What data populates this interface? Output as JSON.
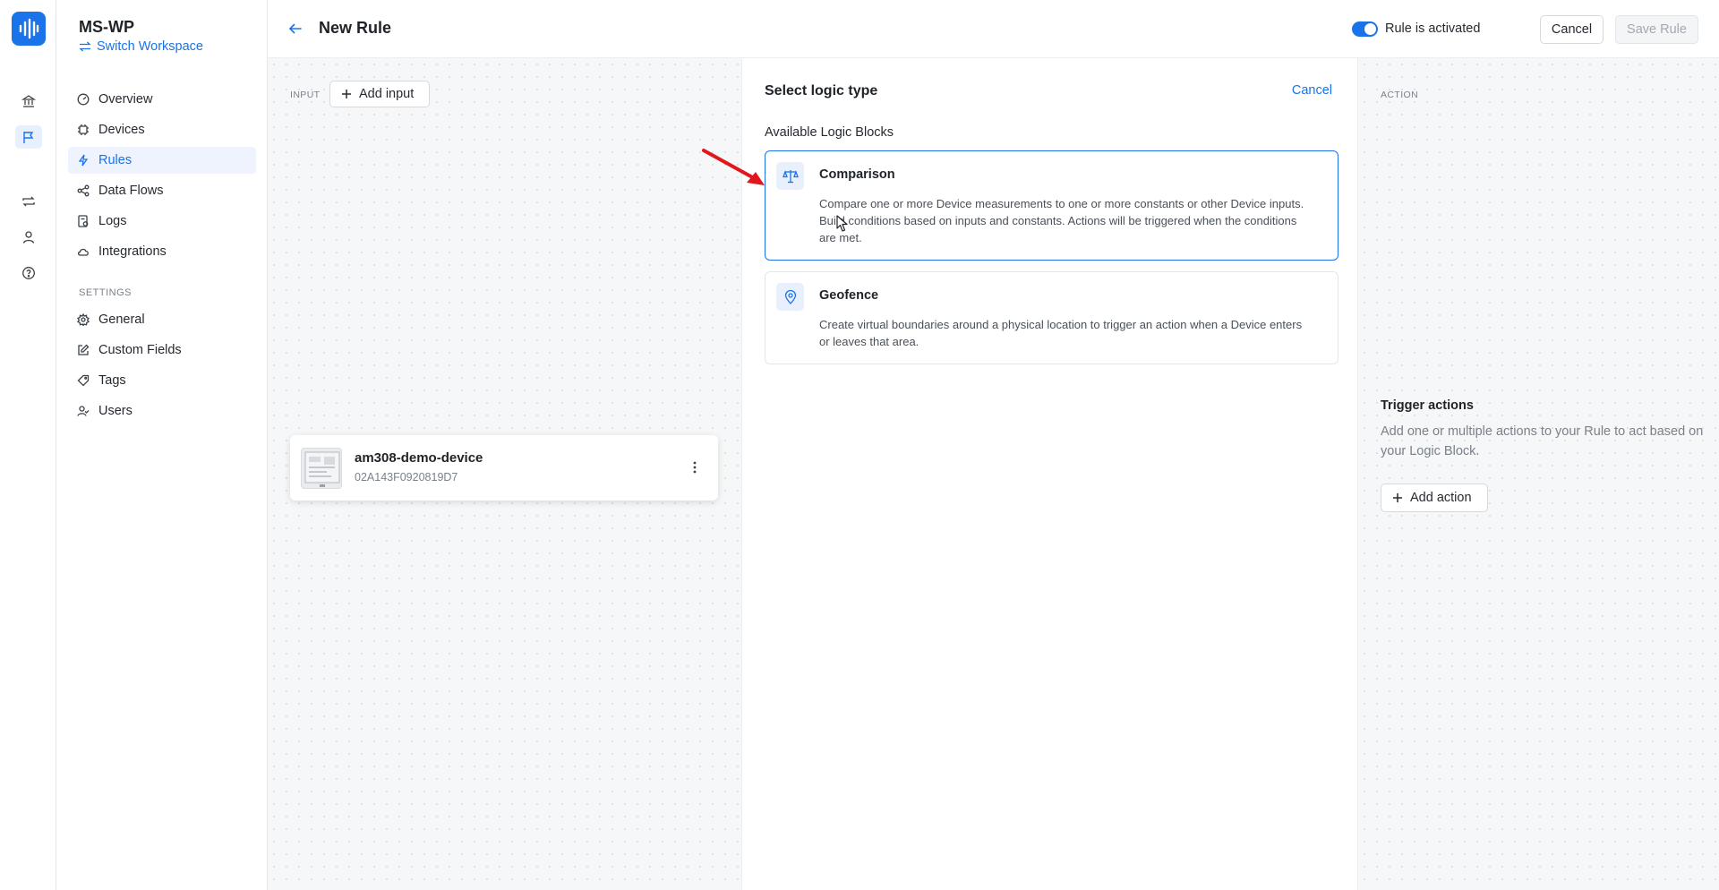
{
  "rail": {
    "icons": [
      "waveform-logo-icon",
      "bank-icon",
      "flag-icon",
      "repeat-icon",
      "user-icon",
      "help-icon"
    ],
    "active": "flag-icon"
  },
  "sidebar": {
    "workspace_name": "MS-WP",
    "switch_label": "Switch Workspace",
    "items": [
      {
        "label": "Overview",
        "icon": "gauge-icon"
      },
      {
        "label": "Devices",
        "icon": "chip-icon"
      },
      {
        "label": "Rules",
        "icon": "lightning-icon",
        "active": true
      },
      {
        "label": "Data Flows",
        "icon": "share-icon"
      },
      {
        "label": "Logs",
        "icon": "log-file-icon"
      },
      {
        "label": "Integrations",
        "icon": "cloud-icon"
      }
    ],
    "settings_heading": "SETTINGS",
    "settings_items": [
      {
        "label": "General",
        "icon": "gear-icon"
      },
      {
        "label": "Custom Fields",
        "icon": "edit-icon"
      },
      {
        "label": "Tags",
        "icon": "tag-icon"
      },
      {
        "label": "Users",
        "icon": "users-icon"
      }
    ]
  },
  "header": {
    "title": "New Rule",
    "toggle_label": "Rule is activated",
    "toggle_on": true,
    "cancel_label": "Cancel",
    "save_label": "Save Rule"
  },
  "input_panel": {
    "label": "INPUT",
    "add_label": "Add input",
    "device": {
      "name": "am308-demo-device",
      "id": "02A143F0920819D7"
    }
  },
  "logic_panel": {
    "title": "Select logic type",
    "cancel_label": "Cancel",
    "subtitle": "Available Logic Blocks",
    "blocks": [
      {
        "name": "Comparison",
        "icon": "scale-icon",
        "description": "Compare one or more Device measurements to one or more constants or other Device inputs. Build conditions based on inputs and constants. Actions will be triggered when the conditions are met."
      },
      {
        "name": "Geofence",
        "icon": "location-pin-icon",
        "description": "Create virtual boundaries around a physical location to trigger an action when a Device enters or leaves that area."
      }
    ]
  },
  "action_panel": {
    "label": "ACTION",
    "trigger_title": "Trigger actions",
    "trigger_desc": "Add one or multiple actions to your Rule to act based on your Logic Block.",
    "add_label": "Add action"
  },
  "colors": {
    "accent": "#1a73e8",
    "annotation_arrow": "#e3161e"
  }
}
